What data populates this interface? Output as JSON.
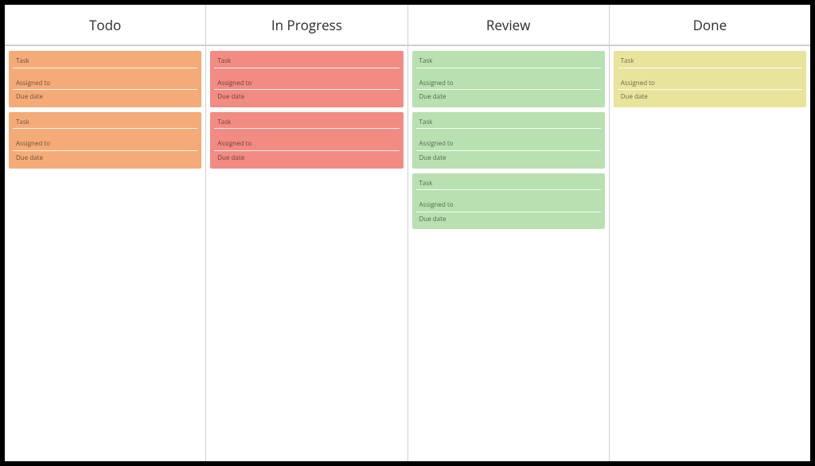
{
  "field_labels": {
    "task": "Task",
    "assigned": "Assigned to",
    "due": "Due date"
  },
  "columns": [
    {
      "id": "todo",
      "title": "Todo",
      "colorClass": "c-todo",
      "cards": [
        {
          "task": "",
          "assigned": "",
          "due": ""
        },
        {
          "task": "",
          "assigned": "",
          "due": ""
        }
      ]
    },
    {
      "id": "inprogress",
      "title": "In Progress",
      "colorClass": "c-inprogress",
      "cards": [
        {
          "task": "",
          "assigned": "",
          "due": ""
        },
        {
          "task": "",
          "assigned": "",
          "due": ""
        }
      ]
    },
    {
      "id": "review",
      "title": "Review",
      "colorClass": "c-review",
      "cards": [
        {
          "task": "",
          "assigned": "",
          "due": ""
        },
        {
          "task": "",
          "assigned": "",
          "due": ""
        },
        {
          "task": "",
          "assigned": "",
          "due": ""
        }
      ]
    },
    {
      "id": "done",
      "title": "Done",
      "colorClass": "c-done",
      "cards": [
        {
          "task": "",
          "assigned": "",
          "due": ""
        }
      ]
    }
  ]
}
